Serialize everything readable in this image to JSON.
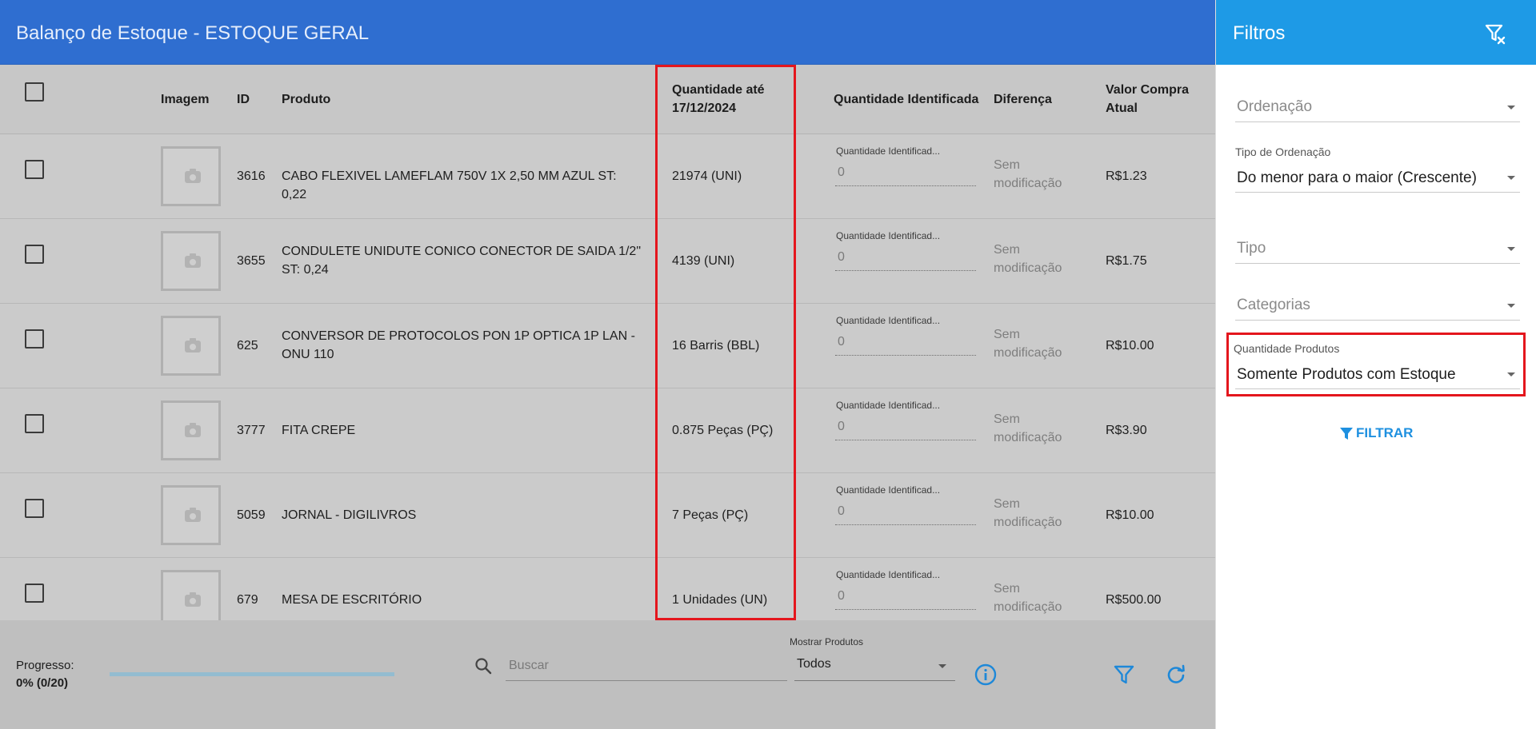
{
  "header": {
    "title": "Balanço de Estoque - ESTOQUE GERAL"
  },
  "table": {
    "columns": {
      "imagem": "Imagem",
      "id": "ID",
      "produto": "Produto",
      "quantidade_ate_line1": "Quantidade até",
      "quantidade_ate_line2": "17/12/2024",
      "quantidade_identificada": "Quantidade Identificada",
      "diferenca": "Diferença",
      "valor_compra_line1": "Valor Compra",
      "valor_compra_line2": "Atual"
    },
    "rows": [
      {
        "id": "3616",
        "produto": "CABO FLEXIVEL LAMEFLAM 750V 1X 2,50 MM AZUL ST: 0,22",
        "quantidade": "21974 (UNI)",
        "qi_label": "Quantidade Identificad...",
        "qi_value": "0",
        "diff_line1": "Sem",
        "diff_line2": "modificação",
        "valor": "R$1.23"
      },
      {
        "id": "3655",
        "produto": "CONDULETE UNIDUTE CONICO CONECTOR DE SAIDA 1/2\" ST: 0,24",
        "quantidade": "4139 (UNI)",
        "qi_label": "Quantidade Identificad...",
        "qi_value": "0",
        "diff_line1": "Sem",
        "diff_line2": "modificação",
        "valor": "R$1.75"
      },
      {
        "id": "625",
        "produto": "CONVERSOR DE PROTOCOLOS PON 1P OPTICA 1P LAN - ONU 110",
        "quantidade": "16 Barris (BBL)",
        "qi_label": "Quantidade Identificad...",
        "qi_value": "0",
        "diff_line1": "Sem",
        "diff_line2": "modificação",
        "valor": "R$10.00"
      },
      {
        "id": "3777",
        "produto": "FITA CREPE",
        "quantidade": "0.875 Peças (PÇ)",
        "qi_label": "Quantidade Identificad...",
        "qi_value": "0",
        "diff_line1": "Sem",
        "diff_line2": "modificação",
        "valor": "R$3.90"
      },
      {
        "id": "5059",
        "produto": "JORNAL - DIGILIVROS",
        "quantidade": "7 Peças (PÇ)",
        "qi_label": "Quantidade Identificad...",
        "qi_value": "0",
        "diff_line1": "Sem",
        "diff_line2": "modificação",
        "valor": "R$10.00"
      },
      {
        "id": "679",
        "produto": "MESA DE ESCRITÓRIO",
        "quantidade": "1 Unidades (UN)",
        "qi_label": "Quantidade Identificad...",
        "qi_value": "0",
        "diff_line1": "Sem",
        "diff_line2": "modificação",
        "valor": "R$500.00"
      }
    ]
  },
  "footer": {
    "progress_label": "Progresso:",
    "progress_value": "0% (0/20)",
    "progress_fraction": 0,
    "search_placeholder": "Buscar",
    "show_products_label": "Mostrar Produtos",
    "show_products_value": "Todos"
  },
  "filters": {
    "title": "Filtros",
    "ordenacao_placeholder": "Ordenação",
    "tipo_ordenacao_label": "Tipo de Ordenação",
    "tipo_ordenacao_value": "Do menor para o maior (Crescente)",
    "tipo_placeholder": "Tipo",
    "categorias_placeholder": "Categorias",
    "quantidade_produtos_label": "Quantidade Produtos",
    "quantidade_produtos_value": "Somente Produtos com Estoque",
    "filtrar_label": "FILTRAR"
  },
  "colors": {
    "header_blue": "#2f6ed0",
    "filters_blue": "#1e9ae6",
    "highlight_red": "#e4161d",
    "accent_blue": "#1e90e0"
  }
}
